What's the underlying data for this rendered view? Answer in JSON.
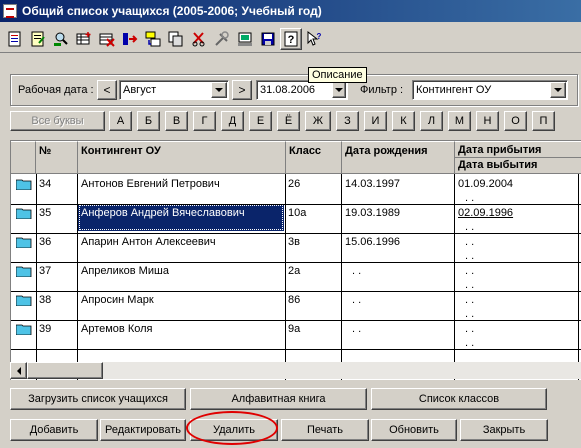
{
  "window": {
    "title": "Общий список учащихся (2005-2006; Учебный год)"
  },
  "toolbar": {
    "icons": [
      "new-record-icon",
      "edit-record-icon",
      "find-icon",
      "add-row-icon",
      "delete-row-icon",
      "move-icon",
      "transfer-icon",
      "copy-icon",
      "cut-icon",
      "tools-icon",
      "print-preview-icon",
      "save-icon",
      "help-icon",
      "whats-this-icon"
    ],
    "tooltip": "Описание"
  },
  "filters": {
    "work_date_label": "Рабочая дата :",
    "prev_symbol": "<",
    "month_value": "Август",
    "next_symbol": ">",
    "date_value": "31.08.2006",
    "filter_label": "Фильтр :",
    "filter_value": "Контингент ОУ"
  },
  "letters": {
    "all_label": "Все буквы",
    "items": [
      "А",
      "Б",
      "В",
      "Г",
      "Д",
      "Е",
      "Ё",
      "Ж",
      "З",
      "И",
      "К",
      "Л",
      "М",
      "Н",
      "О",
      "П"
    ]
  },
  "table": {
    "headers": {
      "num": "№",
      "name": "Контингент ОУ",
      "class": "Класс",
      "birth": "Дата рождения",
      "arrival": "Дата прибытия",
      "departure": "Дата выбытия"
    },
    "rows": [
      {
        "num": "34",
        "name": "Антонов Евгений Петрович",
        "class": "26",
        "birth": "14.03.1997",
        "arrival": "01.09.2004",
        "departure": ". ."
      },
      {
        "num": "35",
        "name": "Анферов Андрей Вячеславович",
        "class": "10а",
        "birth": "19.03.1989",
        "arrival": "02.09.1996",
        "departure": ". ."
      },
      {
        "num": "36",
        "name": "Апарин Антон Алексеевич",
        "class": "3в",
        "birth": "15.06.1996",
        "arrival": ". .",
        "departure": ". ."
      },
      {
        "num": "37",
        "name": "Апреликов Миша",
        "class": "2а",
        "birth": ". .",
        "arrival": ". .",
        "departure": ". ."
      },
      {
        "num": "38",
        "name": "Апросин Марк",
        "class": "86",
        "birth": ". .",
        "arrival": ". .",
        "departure": ". ."
      },
      {
        "num": "39",
        "name": "Артемов Коля",
        "class": "9а",
        "birth": ". .",
        "arrival": ". .",
        "departure": ". ."
      }
    ]
  },
  "buttons_top": {
    "load_list": "Загрузить список учащихся",
    "alpha_book": "Алфавитная книга",
    "class_list": "Список классов"
  },
  "buttons_bottom": {
    "add": "Добавить",
    "edit": "Редактировать",
    "delete": "Удалить",
    "print": "Печать",
    "refresh": "Обновить",
    "close": "Закрыть"
  },
  "colors": {
    "title_start": "#0a246a",
    "title_end": "#3a6ea5",
    "selection": "#0a246a",
    "highlight_oval": "#e00000",
    "folder": "#4ec3e6"
  }
}
